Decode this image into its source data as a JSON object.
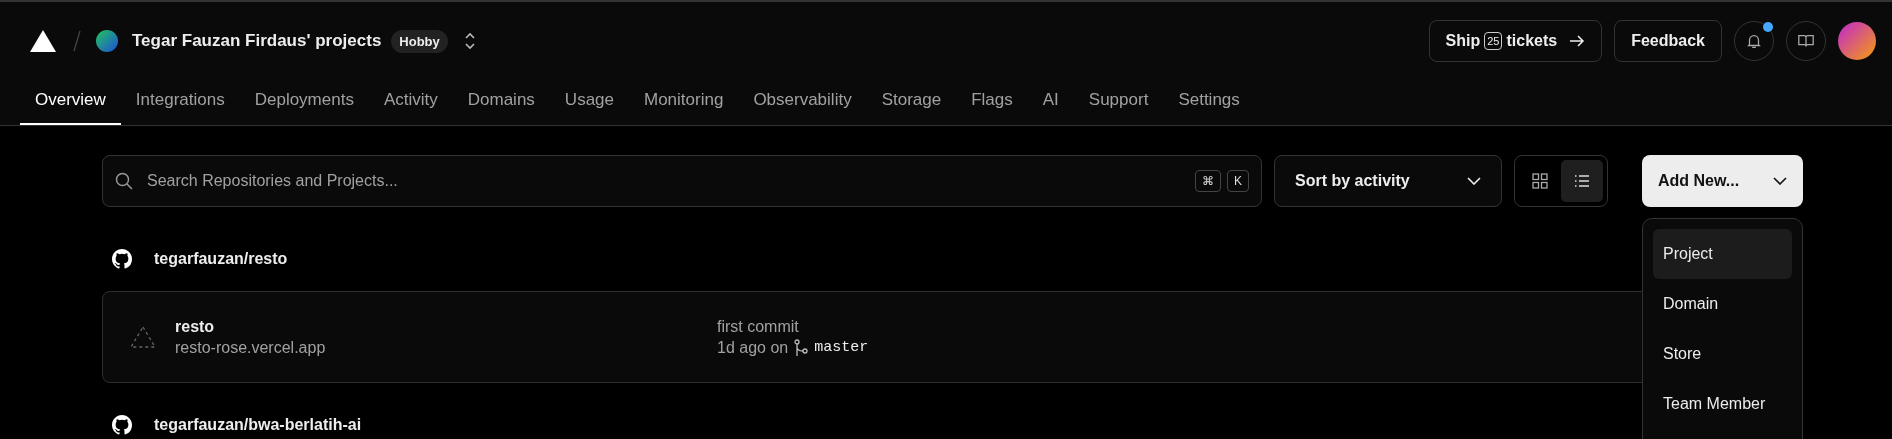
{
  "header": {
    "team_name": "Tegar Fauzan Firdaus' projects",
    "plan_badge": "Hobby",
    "ship_button": {
      "prefix": "Ship",
      "count": "25",
      "suffix": "tickets"
    },
    "feedback_button": "Feedback",
    "notifications_unread": true
  },
  "tabs": [
    {
      "label": "Overview",
      "selected": true
    },
    {
      "label": "Integrations",
      "selected": false
    },
    {
      "label": "Deployments",
      "selected": false
    },
    {
      "label": "Activity",
      "selected": false
    },
    {
      "label": "Domains",
      "selected": false
    },
    {
      "label": "Usage",
      "selected": false
    },
    {
      "label": "Monitoring",
      "selected": false
    },
    {
      "label": "Observability",
      "selected": false
    },
    {
      "label": "Storage",
      "selected": false
    },
    {
      "label": "Flags",
      "selected": false
    },
    {
      "label": "AI",
      "selected": false
    },
    {
      "label": "Support",
      "selected": false
    },
    {
      "label": "Settings",
      "selected": false
    }
  ],
  "toolbar": {
    "search": {
      "placeholder": "Search Repositories and Projects...",
      "shortcut_keys": [
        "⌘",
        "K"
      ]
    },
    "sort": "Sort by activity",
    "views": [
      {
        "kind": "grid",
        "selected": false
      },
      {
        "kind": "list",
        "selected": true
      }
    ],
    "add_new": "Add New..."
  },
  "add_menu": [
    {
      "label": "Project",
      "selected": true
    },
    {
      "label": "Domain",
      "selected": false
    },
    {
      "label": "Store",
      "selected": false
    },
    {
      "label": "Team Member",
      "selected": false
    }
  ],
  "groups": [
    {
      "repo": "tegarfauzan/resto",
      "projects": [
        {
          "name": "resto",
          "url": "resto-rose.vercel.app",
          "commit": "first commit",
          "age": "1d ago on",
          "branch": "master"
        }
      ]
    },
    {
      "repo": "tegarfauzan/bwa-berlatih-ai"
    }
  ]
}
